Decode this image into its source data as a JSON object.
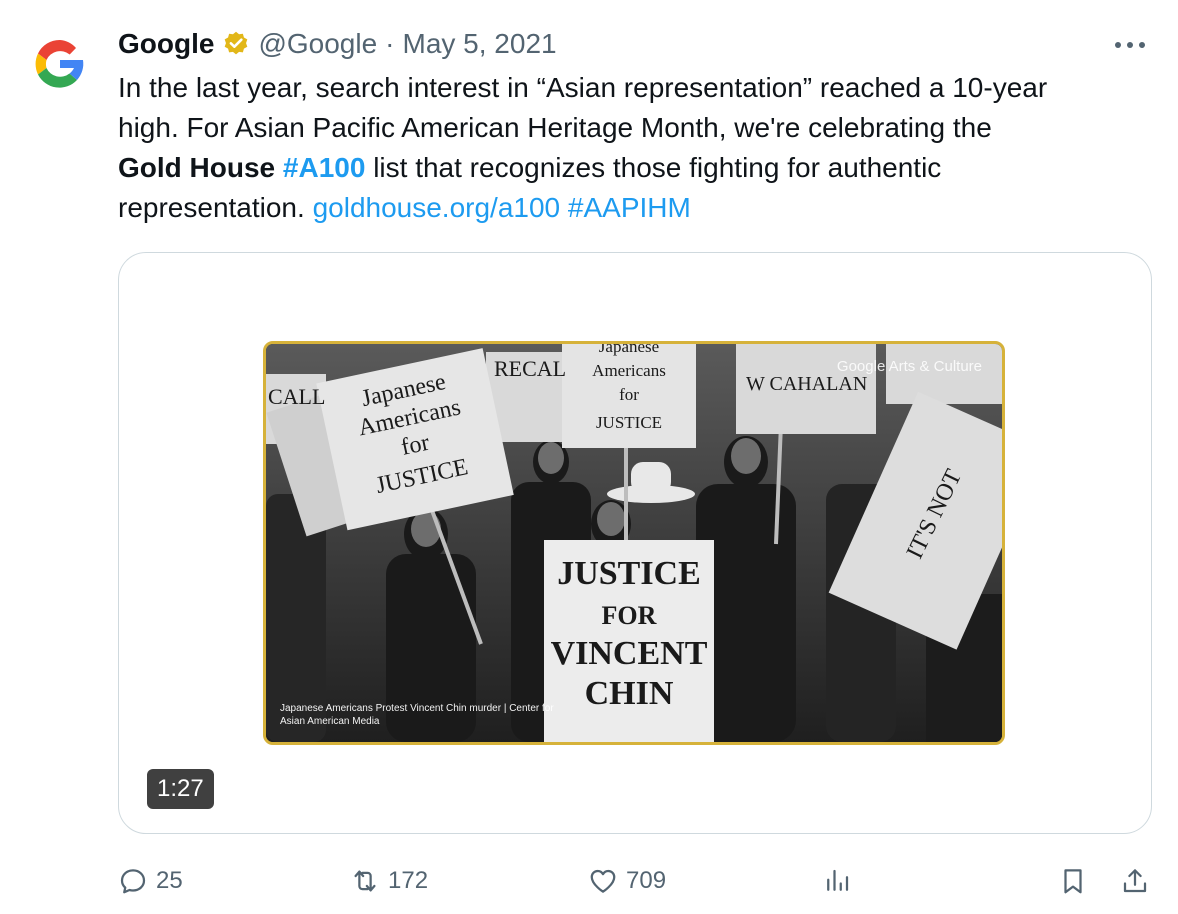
{
  "tweet": {
    "display_name": "Google",
    "handle": "@Google",
    "separator": "·",
    "date": "May 5, 2021",
    "more_label": "•••",
    "text": {
      "line1": "In the last year, search interest in “Asian representation” reached a 10-year",
      "line2": "high. For Asian Pacific American Heritage Month, we're celebrating the",
      "line3_bold": "Gold House",
      "line3_hashtag": "#A100",
      "line3_rest": " list that recognizes those fighting for authentic",
      "line4": "representation. ",
      "link": "goldhouse.org/a100",
      "hashtag": "#AAPIHM"
    }
  },
  "media": {
    "watermark": "Google Arts & Culture",
    "caption": "Japanese Americans Protest Vincent Chin murder | Center for Asian American Media",
    "duration": "1:27",
    "signs": {
      "s1a": "Japanese",
      "s1b": "Americans",
      "s1c": "for",
      "s1d": "JUSTICE",
      "s2a": "Japanese",
      "s2b": "Americans",
      "s2c": "for",
      "s2d": "JUSTICE",
      "s3a": "JUSTICE",
      "s3b": "FOR",
      "s3c": "VINCENT",
      "s3d": "CHIN",
      "s4": "RECAL",
      "s5": "W CAHALAN",
      "s6": "IT'S NOT",
      "s7": "CALL"
    }
  },
  "actions": {
    "replies": "25",
    "retweets": "172",
    "likes": "709"
  },
  "colors": {
    "accent": "#1d9bf0",
    "muted": "#536471",
    "verified_gold": "#e2b719"
  }
}
